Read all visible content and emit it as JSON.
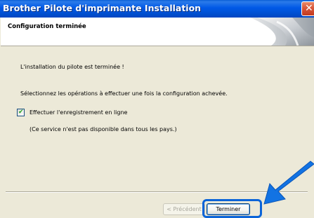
{
  "window": {
    "title": "Brother Pilote d'imprimante Installation",
    "close_icon": "close-icon"
  },
  "header": {
    "title": "Configuration terminée"
  },
  "content": {
    "line1": "L'installation du pilote est terminée !",
    "line2": "Sélectionnez les opérations à effectuer une fois la configuration achevée.",
    "checkbox_label": "Effectuer l'enregistrement en ligne",
    "checkbox_checked": true,
    "note": "(Ce service n'est pas disponible dans tous les pays.)"
  },
  "buttons": {
    "prev_label": "< Précédent",
    "finish_label": "Terminer"
  },
  "colors": {
    "titlebar": "#0058e6",
    "highlight": "#0b64d8",
    "arrow": "#1273e3"
  }
}
